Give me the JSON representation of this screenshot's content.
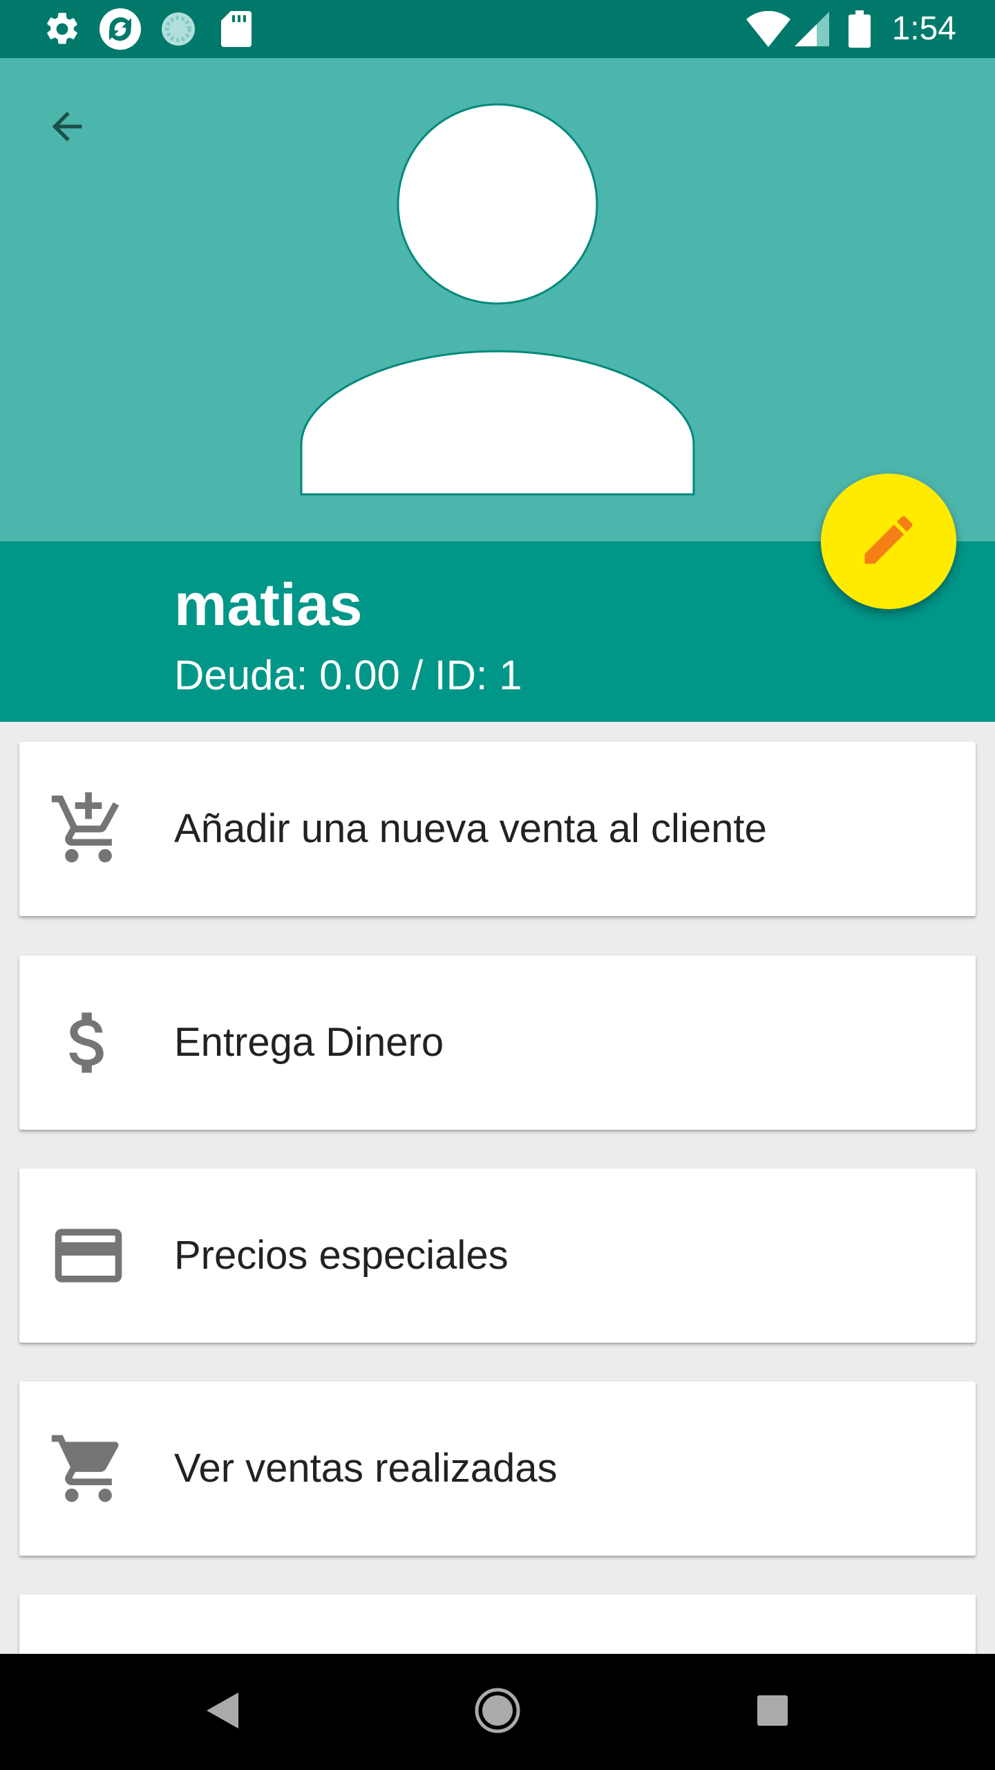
{
  "status_bar": {
    "time": "1:54",
    "icons": [
      "settings-icon",
      "sync-icon",
      "loading-icon",
      "sd-card-icon",
      "wifi-icon",
      "signal-icon",
      "battery-icon"
    ]
  },
  "header": {
    "back_icon": "arrow-back-icon",
    "avatar_icon": "person-placeholder-icon",
    "client_name": "matias",
    "client_subtitle": "Deuda: 0.00 / ID: 1",
    "edit_icon": "pencil-icon"
  },
  "actions": [
    {
      "label": "Añadir una nueva venta al cliente",
      "icon": "add-shopping-cart-icon"
    },
    {
      "label": "Entrega Dinero",
      "icon": "dollar-sign-icon"
    },
    {
      "label": "Precios especiales",
      "icon": "credit-card-icon"
    },
    {
      "label": "Ver ventas realizadas",
      "icon": "shopping-cart-icon"
    },
    {
      "label": "",
      "icon": "card-icon"
    }
  ],
  "nav_bar": {
    "buttons": [
      "back-triangle-icon",
      "home-circle-icon",
      "recents-square-icon"
    ]
  },
  "colors": {
    "status_bar": "#00796b",
    "header_light": "#4db6ac",
    "header_dark": "#009688",
    "fab": "#ffeb00",
    "fab_icon": "#f57f17",
    "icon_gray": "#757575",
    "background": "#ececec"
  }
}
